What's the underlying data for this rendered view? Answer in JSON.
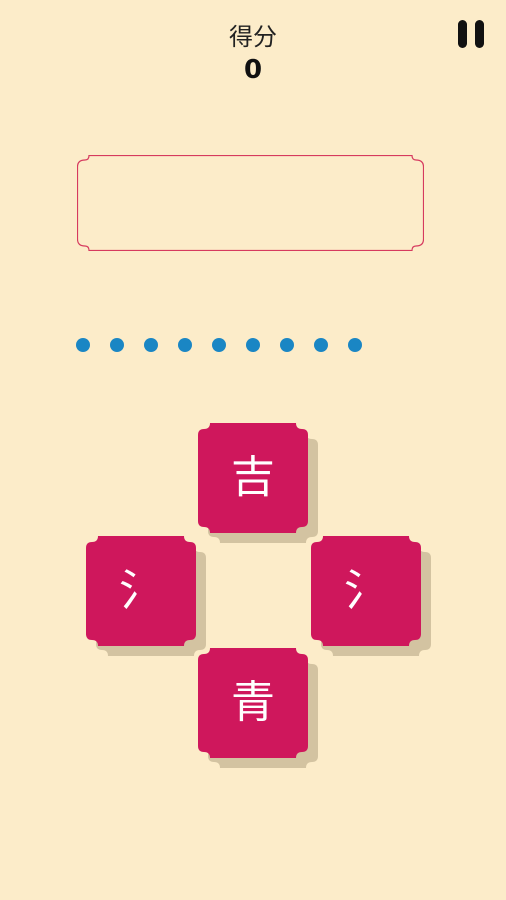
{
  "score": {
    "label": "得分",
    "value": "0"
  },
  "pause_button": {
    "icon": "pause-icon"
  },
  "answer_box": {
    "text": ""
  },
  "progress": {
    "total_dots": 9
  },
  "tiles": {
    "top": "吉",
    "left": "氵",
    "right": "氵",
    "bottom": "青"
  },
  "colors": {
    "background": "#fcecc9",
    "tile": "#cf175c",
    "tile_shadow": "#d3c3a1",
    "dot": "#1a86c4",
    "box_border": "#d63a5e"
  }
}
